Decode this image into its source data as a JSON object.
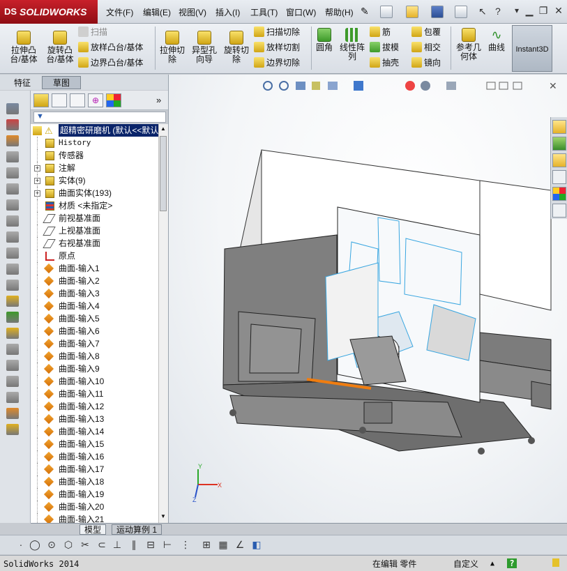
{
  "app": {
    "brand": "SOLIDWORKS",
    "brand_mark": "DS"
  },
  "menu": [
    "文件(F)",
    "编辑(E)",
    "视图(V)",
    "插入(I)",
    "工具(T)",
    "窗口(W)",
    "帮助(H)"
  ],
  "ribbon": {
    "extrude_boss": "拉伸凸\n台/基体",
    "revolve_boss": "旋转凸\n台/基体",
    "sweep": "扫描",
    "loft_boss": "放样凸台/基体",
    "boundary_boss": "边界凸台/基体",
    "extrude_cut": "拉伸切\n除",
    "hole_wizard": "异型孔\n向导",
    "revolve_cut": "旋转切\n除",
    "swept_cut": "扫描切除",
    "lofted_cut": "放样切割",
    "boundary_cut": "边界切除",
    "fillet": "圆角",
    "linear_pattern": "线性阵\n列",
    "rib": "筋",
    "draft": "拔模",
    "shell": "抽壳",
    "wrap": "包覆",
    "intersect": "相交",
    "mirror": "镜向",
    "ref_geometry": "参考几\n何体",
    "curves": "曲线",
    "instant3d": "Instant3D"
  },
  "panel_tabs": [
    "特征",
    "草图"
  ],
  "tree": {
    "root": "超精密研磨机  (默认<<默认",
    "items": [
      {
        "label": "History",
        "kind": "history",
        "expand": false
      },
      {
        "label": "传感器",
        "kind": "sensor",
        "expand": false
      },
      {
        "label": "注解",
        "kind": "annotation",
        "expand": true
      },
      {
        "label": "实体(9)",
        "kind": "solid",
        "expand": true
      },
      {
        "label": "曲面实体(193)",
        "kind": "surfbody",
        "expand": true
      },
      {
        "label": "材质 <未指定>",
        "kind": "material",
        "expand": false
      },
      {
        "label": "前视基准面",
        "kind": "plane",
        "expand": false
      },
      {
        "label": "上视基准面",
        "kind": "plane",
        "expand": false
      },
      {
        "label": "右视基准面",
        "kind": "plane",
        "expand": false
      },
      {
        "label": "原点",
        "kind": "origin",
        "expand": false
      },
      {
        "label": "曲面-输入1",
        "kind": "surface",
        "expand": false
      },
      {
        "label": "曲面-输入2",
        "kind": "surface",
        "expand": false
      },
      {
        "label": "曲面-输入3",
        "kind": "surface",
        "expand": false
      },
      {
        "label": "曲面-输入4",
        "kind": "surface",
        "expand": false
      },
      {
        "label": "曲面-输入5",
        "kind": "surface",
        "expand": false
      },
      {
        "label": "曲面-输入6",
        "kind": "surface",
        "expand": false
      },
      {
        "label": "曲面-输入7",
        "kind": "surface",
        "expand": false
      },
      {
        "label": "曲面-输入8",
        "kind": "surface",
        "expand": false
      },
      {
        "label": "曲面-输入9",
        "kind": "surface",
        "expand": false
      },
      {
        "label": "曲面-输入10",
        "kind": "surface",
        "expand": false
      },
      {
        "label": "曲面-输入11",
        "kind": "surface",
        "expand": false
      },
      {
        "label": "曲面-输入12",
        "kind": "surface",
        "expand": false
      },
      {
        "label": "曲面-输入13",
        "kind": "surface",
        "expand": false
      },
      {
        "label": "曲面-输入14",
        "kind": "surface",
        "expand": false
      },
      {
        "label": "曲面-输入15",
        "kind": "surface",
        "expand": false
      },
      {
        "label": "曲面-输入16",
        "kind": "surface",
        "expand": false
      },
      {
        "label": "曲面-输入17",
        "kind": "surface",
        "expand": false
      },
      {
        "label": "曲面-输入18",
        "kind": "surface",
        "expand": false
      },
      {
        "label": "曲面-输入19",
        "kind": "surface",
        "expand": false
      },
      {
        "label": "曲面-输入20",
        "kind": "surface",
        "expand": false
      },
      {
        "label": "曲面-输入21",
        "kind": "surface",
        "expand": false
      }
    ]
  },
  "bottom_tabs": [
    "模型",
    "运动算例 1"
  ],
  "triad": {
    "x": "X",
    "y": "Y",
    "z": "Z"
  },
  "status": {
    "app_version": "SolidWorks 2014",
    "mode": "在编辑 零件",
    "units": "自定义"
  },
  "colors": {
    "accent": "#c8202a",
    "model_edge": "#39a6e0",
    "highlight": "#f07d10"
  }
}
